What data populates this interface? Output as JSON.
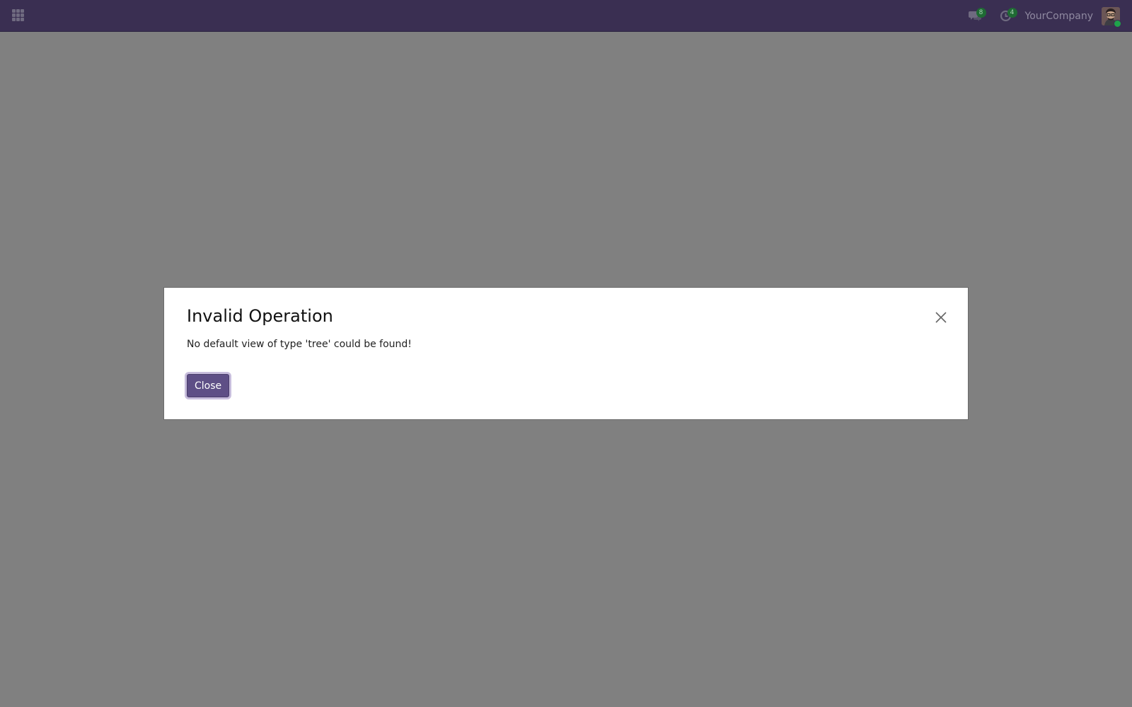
{
  "navbar": {
    "apps_icon": "grid-icon",
    "messaging": {
      "icon": "chat-bubbles-icon",
      "count": "8"
    },
    "activity": {
      "icon": "clock-icon",
      "count": "4"
    },
    "company_name": "YourCompany",
    "avatar_icon": "user-avatar",
    "status_color": "#1fa34a",
    "background_color": "#3a2f52"
  },
  "dialog": {
    "title": "Invalid Operation",
    "message": "No default view of type 'tree' could be found!",
    "close_icon": "close-icon",
    "close_button_label": "Close",
    "primary_color": "#5e4f86"
  },
  "backdrop_color": "#808080"
}
